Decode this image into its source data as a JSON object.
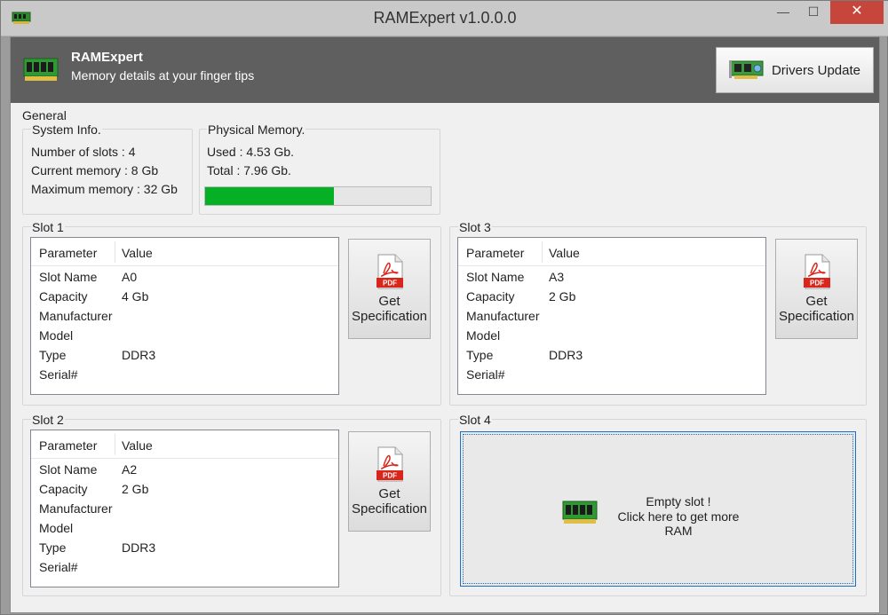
{
  "window": {
    "title": "RAMExpert v1.0.0.0",
    "minimize_glyph": "—",
    "maximize_glyph": "☐",
    "close_glyph": "✕",
    "icon": "ram-chip-icon"
  },
  "header": {
    "app_name": "RAMExpert",
    "tagline": "Memory details at your finger tips",
    "drivers_button": "Drivers Update",
    "logo_icon": "ram-chip-icon",
    "drivers_icon": "graphics-card-icon"
  },
  "general": {
    "label": "General",
    "system_info": {
      "label": "System Info.",
      "slots": "Number of slots : 4",
      "current": "Current memory : 8 Gb",
      "maximum": "Maximum memory : 32 Gb"
    },
    "physical_memory": {
      "label": "Physical Memory.",
      "used": "Used : 4.53 Gb.",
      "total": "Total : 7.96 Gb.",
      "used_fraction": 0.569
    }
  },
  "table_headers": {
    "parameter": "Parameter",
    "value": "Value"
  },
  "spec_button": {
    "line1": "Get",
    "line2": "Specification",
    "icon": "pdf-icon",
    "badge": "PDF"
  },
  "slots": [
    {
      "label": "Slot 1",
      "rows": [
        {
          "param": "Slot Name",
          "value": "A0"
        },
        {
          "param": "Capacity",
          "value": "4 Gb"
        },
        {
          "param": "Manufacturer",
          "value": ""
        },
        {
          "param": "Model",
          "value": ""
        },
        {
          "param": "Type",
          "value": "DDR3"
        },
        {
          "param": "Serial#",
          "value": ""
        }
      ]
    },
    {
      "label": "Slot 2",
      "rows": [
        {
          "param": "Slot Name",
          "value": "A2"
        },
        {
          "param": "Capacity",
          "value": "2 Gb"
        },
        {
          "param": "Manufacturer",
          "value": ""
        },
        {
          "param": "Model",
          "value": ""
        },
        {
          "param": "Type",
          "value": "DDR3"
        },
        {
          "param": "Serial#",
          "value": ""
        }
      ]
    },
    {
      "label": "Slot 3",
      "rows": [
        {
          "param": "Slot Name",
          "value": "A3"
        },
        {
          "param": "Capacity",
          "value": "2 Gb"
        },
        {
          "param": "Manufacturer",
          "value": ""
        },
        {
          "param": "Model",
          "value": ""
        },
        {
          "param": "Type",
          "value": "DDR3"
        },
        {
          "param": "Serial#",
          "value": ""
        }
      ]
    },
    {
      "label": "Slot 4",
      "empty_line1": "Empty slot !",
      "empty_line2": "Click here to get more RAM",
      "icon": "ram-chip-icon"
    }
  ],
  "colors": {
    "header_bg": "#5f5f5f",
    "progress_fill": "#06b025",
    "close_button": "#c7463b",
    "pdf_red": "#d9261c"
  }
}
